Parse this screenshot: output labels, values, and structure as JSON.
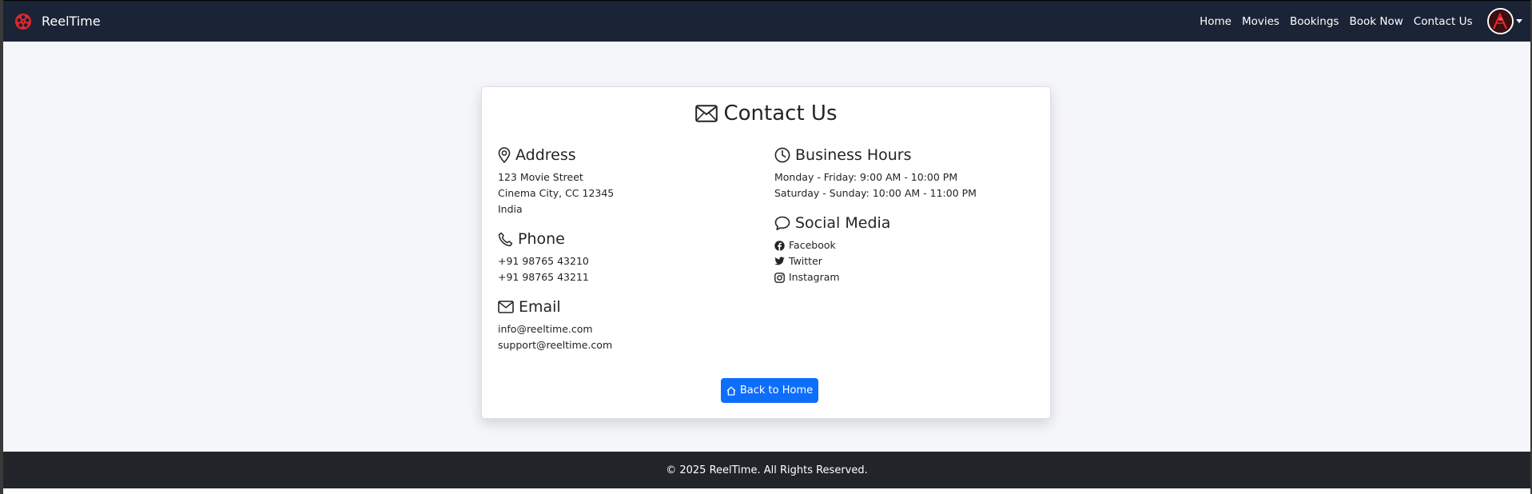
{
  "navbar": {
    "brand": "ReelTime",
    "links": [
      "Home",
      "Movies",
      "Bookings",
      "Book Now",
      "Contact Us"
    ]
  },
  "contact": {
    "title": "Contact Us",
    "address": {
      "heading": "Address",
      "lines": [
        "123 Movie Street",
        "Cinema City, CC 12345",
        "India"
      ]
    },
    "phone": {
      "heading": "Phone",
      "lines": [
        "+91 98765 43210",
        "+91 98765 43211"
      ]
    },
    "email": {
      "heading": "Email",
      "lines": [
        "info@reeltime.com",
        "support@reeltime.com"
      ]
    },
    "hours": {
      "heading": "Business Hours",
      "lines": [
        "Monday - Friday: 9:00 AM - 10:00 PM",
        "Saturday - Sunday: 10:00 AM - 11:00 PM"
      ]
    },
    "social": {
      "heading": "Social Media",
      "items": [
        "Facebook",
        "Twitter",
        "Instagram"
      ]
    },
    "back_button": "Back to Home"
  },
  "footer": {
    "text": "© 2025 ReelTime. All Rights Reserved."
  },
  "colors": {
    "navbar": "#1b2336",
    "accent": "#0d6efd",
    "footer": "#212529",
    "logo": "#e0282e"
  }
}
